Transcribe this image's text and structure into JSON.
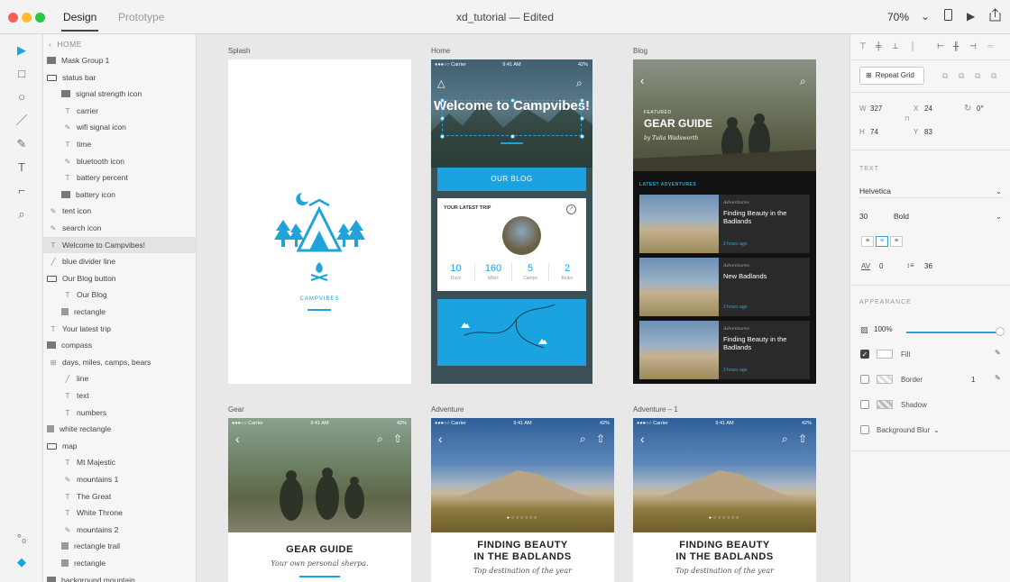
{
  "window": {
    "mode_tabs": [
      "Design",
      "Prototype"
    ],
    "title": "xd_tutorial — Edited",
    "zoom": "70%"
  },
  "layers": {
    "breadcrumb": "HOME",
    "items": [
      {
        "label": "Mask Group 1",
        "icon": "image-icon",
        "indent": 0
      },
      {
        "label": "status bar",
        "icon": "folder-icon",
        "indent": 0
      },
      {
        "label": "signal strength icon",
        "icon": "image-icon",
        "indent": 1
      },
      {
        "label": "carrier",
        "icon": "text-icon",
        "indent": 1
      },
      {
        "label": "wifi signal icon",
        "icon": "pen-icon",
        "indent": 1
      },
      {
        "label": "time",
        "icon": "text-icon",
        "indent": 1
      },
      {
        "label": "bluetooth icon",
        "icon": "pen-icon",
        "indent": 1
      },
      {
        "label": "battery percent",
        "icon": "text-icon",
        "indent": 1
      },
      {
        "label": "battery icon",
        "icon": "image-icon",
        "indent": 1
      },
      {
        "label": "tent icon",
        "icon": "pen-icon",
        "indent": 0
      },
      {
        "label": "search icon",
        "icon": "pen-icon",
        "indent": 0
      },
      {
        "label": "Welcome to Campvibes!",
        "icon": "text-icon",
        "indent": 0,
        "selected": true
      },
      {
        "label": "blue divider line",
        "icon": "line-icon",
        "indent": 0
      },
      {
        "label": "Our Blog button",
        "icon": "folder-icon",
        "indent": 0
      },
      {
        "label": "Our Blog",
        "icon": "text-icon",
        "indent": 1
      },
      {
        "label": "rectangle",
        "icon": "rect-icon",
        "indent": 1
      },
      {
        "label": "Your latest trip",
        "icon": "text-icon",
        "indent": 0
      },
      {
        "label": "compass",
        "icon": "image-icon",
        "indent": 0
      },
      {
        "label": "days, miles, camps, bears",
        "icon": "grid-icon",
        "indent": 0
      },
      {
        "label": "line",
        "icon": "line-icon",
        "indent": 1
      },
      {
        "label": "text",
        "icon": "text-icon",
        "indent": 1
      },
      {
        "label": "numbers",
        "icon": "text-icon",
        "indent": 1
      },
      {
        "label": "white rectangle",
        "icon": "rect-icon",
        "indent": 0
      },
      {
        "label": "map",
        "icon": "folder-icon",
        "indent": 0
      },
      {
        "label": "Mt Majestic",
        "icon": "text-icon",
        "indent": 1
      },
      {
        "label": "mountains 1",
        "icon": "pen-icon",
        "indent": 1
      },
      {
        "label": "The Great",
        "icon": "text-icon",
        "indent": 1
      },
      {
        "label": "White Throne",
        "icon": "text-icon",
        "indent": 1
      },
      {
        "label": "mountains 2",
        "icon": "pen-icon",
        "indent": 1
      },
      {
        "label": "rectangle trail",
        "icon": "rect-icon",
        "indent": 1
      },
      {
        "label": "rectangle",
        "icon": "rect-icon",
        "indent": 1
      },
      {
        "label": "background mountain",
        "icon": "image-icon",
        "indent": 0
      }
    ]
  },
  "artboards": {
    "splash": {
      "label": "Splash",
      "brand": "CAMPVIBES"
    },
    "home": {
      "label": "Home",
      "status": {
        "carrier": "●●●○○ Carrier",
        "time": "9:41 AM",
        "battery": "42%"
      },
      "welcome": "Welcome to Campvibes!",
      "blog_button": "OUR BLOG",
      "trip_title": "YOUR LATEST TRIP",
      "stats": [
        {
          "value": "10",
          "unit": "Days"
        },
        {
          "value": "160",
          "unit": "Miles"
        },
        {
          "value": "5",
          "unit": "Camps"
        },
        {
          "value": "2",
          "unit": "Bears"
        }
      ]
    },
    "blog": {
      "label": "Blog",
      "kicker": "FEATURED",
      "title": "GEAR GUIDE",
      "byline": "by Tulia Wadsworth",
      "section": "LATEST ADVENTURES",
      "cards": [
        {
          "category": "Adventures",
          "title": "Finding Beauty in the Badlands",
          "ago": "2 hours ago"
        },
        {
          "category": "Adventures",
          "title": "New Badlands",
          "ago": "2 hours ago"
        },
        {
          "category": "Adventures",
          "title": "Finding Beauty in the Badlands",
          "ago": "2 hours ago"
        }
      ]
    },
    "gear": {
      "label": "Gear",
      "title": "GEAR GUIDE",
      "subtitle": "Your own personal sherpa."
    },
    "adventure": {
      "label": "Adventure",
      "title_line1": "FINDING BEAUTY",
      "title_line2": "IN THE BADLANDS",
      "subtitle": "Top destination of the year"
    },
    "adventure2": {
      "label": "Adventure – 1",
      "title_line1": "FINDING BEAUTY",
      "title_line2": "IN THE BADLANDS",
      "subtitle": "Top destination of the year"
    }
  },
  "inspector": {
    "repeat_grid": "Repeat Grid",
    "w": "327",
    "x": "24",
    "h": "74",
    "y": "83",
    "rotation": "0°",
    "text_section": "TEXT",
    "font_family": "Helvetica",
    "font_size": "30",
    "font_weight": "Bold",
    "char_spacing": "0",
    "line_spacing": "36",
    "appearance_section": "APPEARANCE",
    "opacity": "100%",
    "opacity_value": 1.0,
    "fill_label": "Fill",
    "fill_checked": true,
    "border_label": "Border",
    "border_width": "1",
    "border_checked": false,
    "shadow_label": "Shadow",
    "shadow_checked": false,
    "blur_label": "Background Blur",
    "blur_checked": false
  },
  "colors": {
    "accent": "#1aa3df",
    "selection": "#2f9fe0"
  }
}
